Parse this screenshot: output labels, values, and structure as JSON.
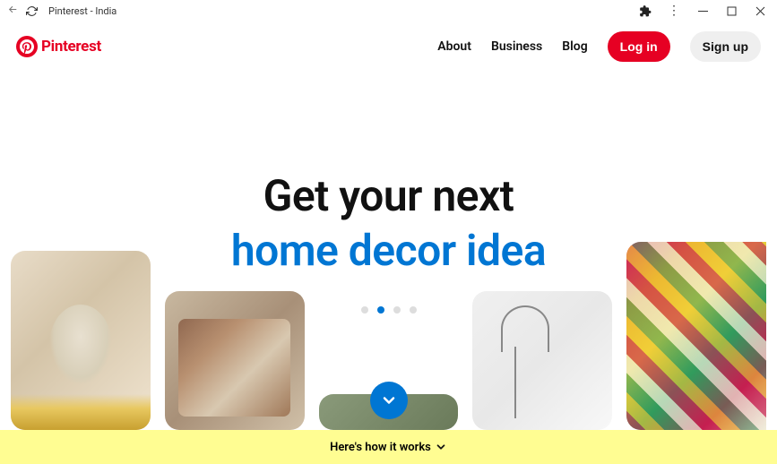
{
  "browser": {
    "title": "Pinterest - India"
  },
  "brand": {
    "name": "Pinterest",
    "color": "#e60023"
  },
  "nav": {
    "about": "About",
    "business": "Business",
    "blog": "Blog",
    "login": "Log in",
    "signup": "Sign up"
  },
  "hero": {
    "line1": "Get your next",
    "line2": "home decor idea",
    "accent_color": "#0076d3",
    "active_dot_index": 1,
    "dot_count": 4
  },
  "footer": {
    "text": "Here's how it works"
  }
}
